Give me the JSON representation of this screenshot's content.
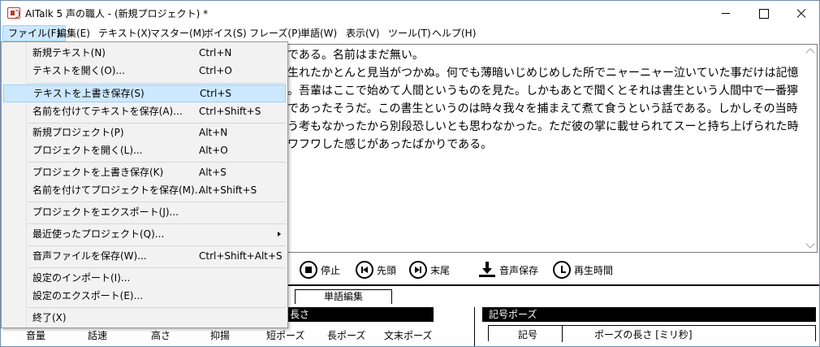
{
  "window": {
    "title": "AITalk 5 声の職人 - (新規プロジェクト) *"
  },
  "menubar": [
    "ファイル(F)",
    "編集(E)",
    "テキスト(X)",
    "マスター(M)",
    "ボイス(S)",
    "フレーズ(P)",
    "単語(W)",
    "表示(V)",
    "ツール(T)",
    "ヘルプ(H)"
  ],
  "editor": {
    "lines": [
      "である。名前はまだ無い。",
      "生れたかとんと見当がつかぬ。何でも薄暗いじめじめした所でニャーニャー泣いていた事だけは記憶",
      "。吾輩はここで始めて人間というものを見た。しかもあとで聞くとそれは書生という人間中で一番獰",
      "であったそうだ。この書生というのは時々我々を捕まえて煮て食うという話である。しかしその当時",
      "う考もなかったから別段恐しいとも思わなかった。ただ彼の掌に載せられてスーと持ち上げられた時",
      "ワフワした感じがあったばかりである。"
    ]
  },
  "toolbar": {
    "stop": "停止",
    "first": "先頭",
    "last": "末尾",
    "save_audio": "音声保存",
    "play_time": "再生時間"
  },
  "lower": {
    "tab_word_edit": "単語編集",
    "left_header": "長さ",
    "columns": [
      "音量",
      "話速",
      "高さ",
      "抑揚",
      "短ポーズ",
      "長ポーズ",
      "文末ポーズ"
    ],
    "right_header": "記号ポーズ",
    "right_cols": [
      "記号",
      "ポーズの長さ [ミリ秒]"
    ]
  },
  "file_menu": {
    "items": [
      {
        "label": "新規テキスト(N)",
        "shortcut": "Ctrl+N"
      },
      {
        "label": "テキストを開く(O)...",
        "shortcut": "Ctrl+O"
      },
      {
        "label": "テキストを上書き保存(S)",
        "shortcut": "Ctrl+S"
      },
      {
        "label": "名前を付けてテキストを保存(A)...",
        "shortcut": "Ctrl+Shift+S"
      },
      {
        "label": "新規プロジェクト(P)",
        "shortcut": "Alt+N"
      },
      {
        "label": "プロジェクトを開く(L)...",
        "shortcut": "Alt+O"
      },
      {
        "label": "プロジェクトを上書き保存(K)",
        "shortcut": "Alt+S"
      },
      {
        "label": "名前を付けてプロジェクトを保存(M)...",
        "shortcut": "Alt+Shift+S"
      },
      {
        "label": "プロジェクトをエクスポート(J)...",
        "shortcut": ""
      },
      {
        "label": "最近使ったプロジェクト(Q)...",
        "shortcut": ""
      },
      {
        "label": "音声ファイルを保存(W)...",
        "shortcut": "Ctrl+Shift+Alt+S"
      },
      {
        "label": "設定のインポート(I)...",
        "shortcut": ""
      },
      {
        "label": "設定のエクスポート(E)...",
        "shortcut": ""
      },
      {
        "label": "終了(X)",
        "shortcut": ""
      }
    ]
  }
}
